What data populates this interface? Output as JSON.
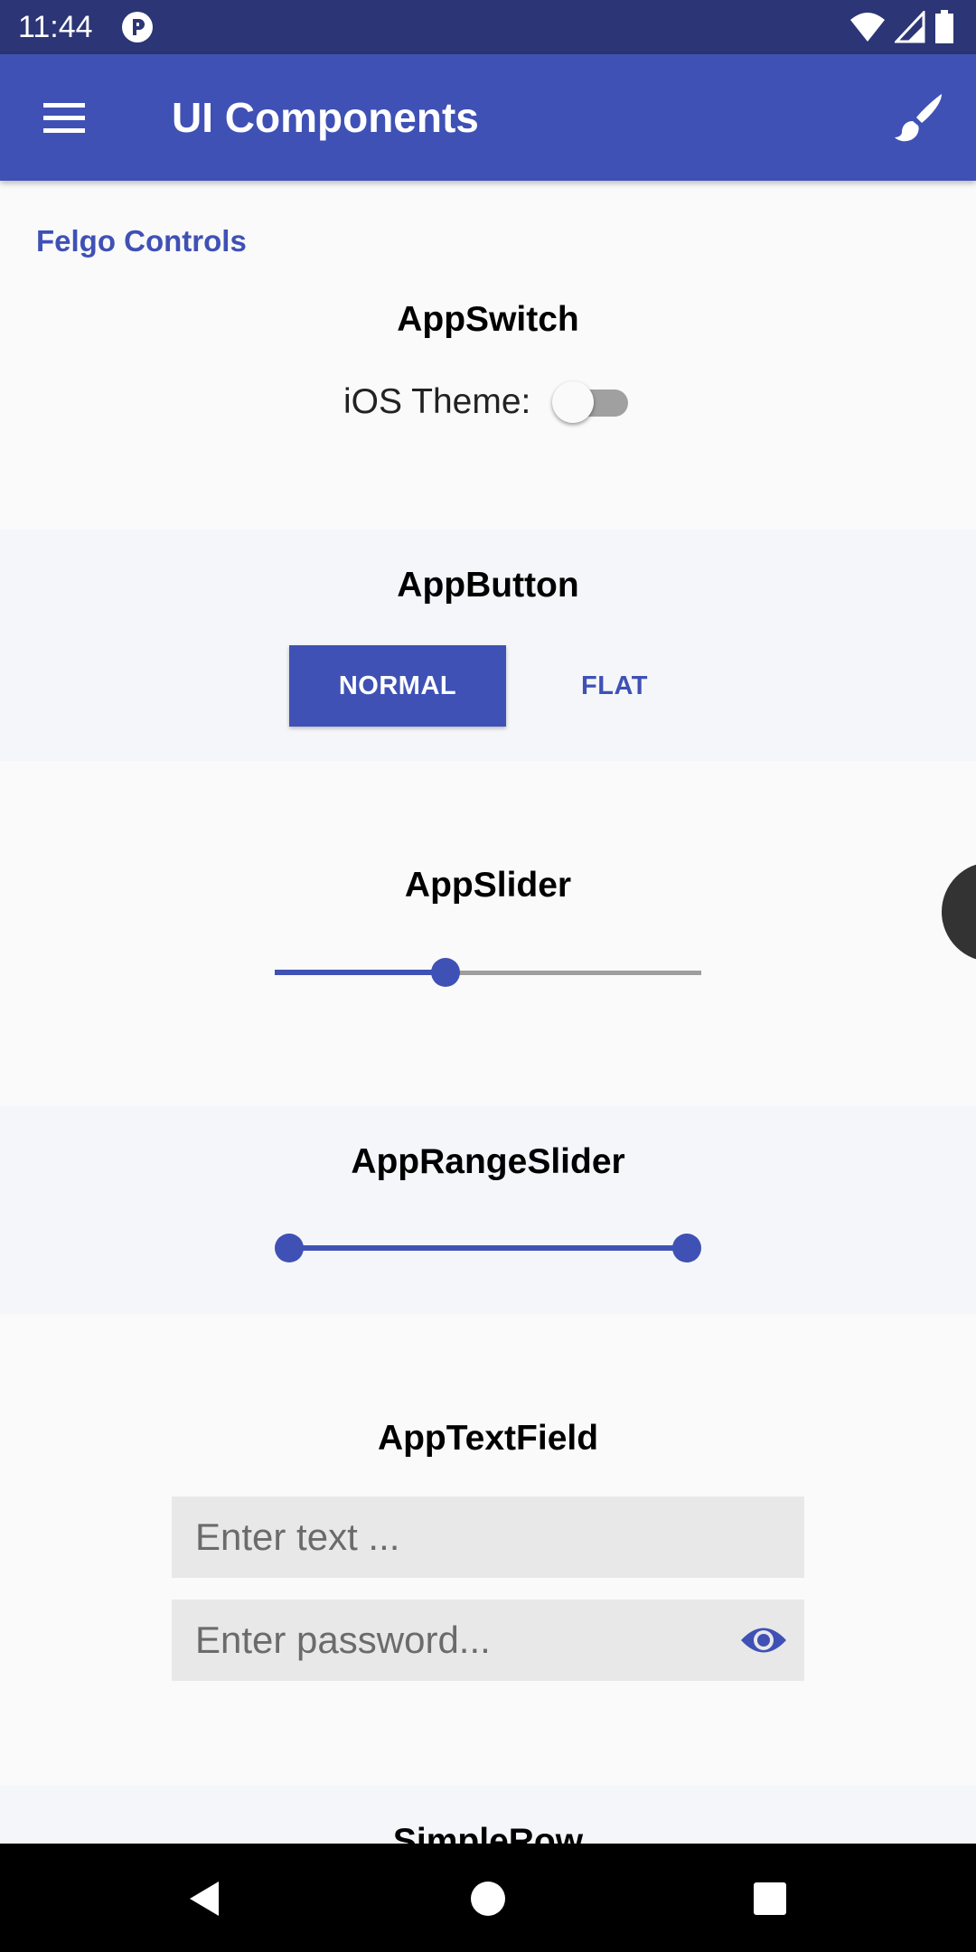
{
  "status_bar": {
    "time": "11:44"
  },
  "app_bar": {
    "title": "UI Components"
  },
  "section_header": "Felgo Controls",
  "app_switch": {
    "title": "AppSwitch",
    "label": "iOS Theme:",
    "checked": false
  },
  "app_button": {
    "title": "AppButton",
    "normal_label": "NORMAL",
    "flat_label": "FLAT"
  },
  "app_slider": {
    "title": "AppSlider",
    "value": 0.4
  },
  "app_range_slider": {
    "title": "AppRangeSlider",
    "low": 0.0,
    "high": 1.0
  },
  "app_text_field": {
    "title": "AppTextField",
    "text_placeholder": "Enter text ...",
    "password_placeholder": "Enter password..."
  },
  "simple_row": {
    "title": "SimpleRow"
  },
  "colors": {
    "primary": "#3f51b5",
    "status_bar": "#2c3575",
    "track_inactive": "#9e9e9e"
  }
}
